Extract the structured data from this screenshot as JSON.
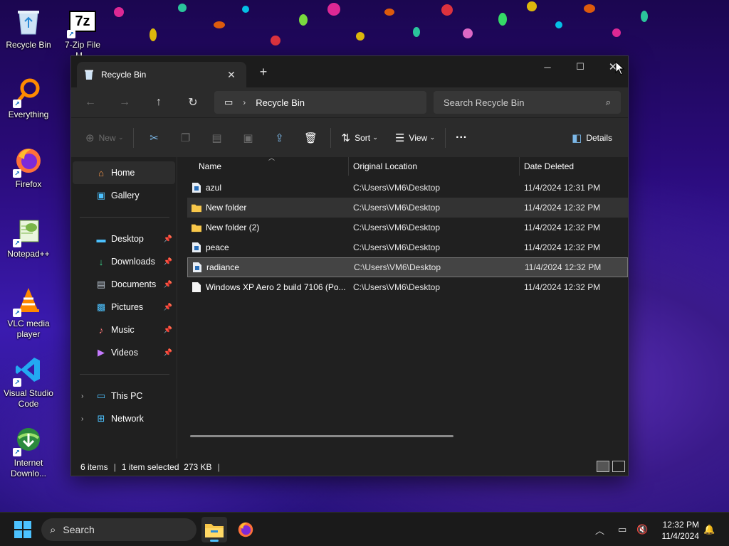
{
  "desktop": {
    "icons": [
      {
        "label": "Recycle Bin",
        "icon": "recycle-bin-icon"
      },
      {
        "label": "7-Zip File M...",
        "icon": "7zip-icon"
      },
      {
        "label": "Everything",
        "icon": "everything-icon"
      },
      {
        "label": "Firefox",
        "icon": "firefox-icon"
      },
      {
        "label": "Notepad++",
        "icon": "notepadpp-icon"
      },
      {
        "label": "VLC media player",
        "icon": "vlc-icon"
      },
      {
        "label": "Visual Studio Code",
        "icon": "vscode-icon"
      },
      {
        "label": "Internet Downlo...",
        "icon": "idm-icon"
      }
    ]
  },
  "window": {
    "tab_title": "Recycle Bin",
    "address": "Recycle Bin",
    "search_placeholder": "Search Recycle Bin",
    "commands": {
      "new": "New",
      "sort": "Sort",
      "view": "View",
      "more": "···",
      "details": "Details"
    },
    "nav": {
      "home": "Home",
      "gallery": "Gallery",
      "desktop": "Desktop",
      "downloads": "Downloads",
      "documents": "Documents",
      "pictures": "Pictures",
      "music": "Music",
      "videos": "Videos",
      "this_pc": "This PC",
      "network": "Network"
    },
    "columns": {
      "name": "Name",
      "location": "Original Location",
      "date": "Date Deleted"
    },
    "files": [
      {
        "name": "azul",
        "location": "C:\\Users\\VM6\\Desktop",
        "date": "11/4/2024 12:31 PM",
        "type": "file"
      },
      {
        "name": "New folder",
        "location": "C:\\Users\\VM6\\Desktop",
        "date": "11/4/2024 12:32 PM",
        "type": "folder"
      },
      {
        "name": "New folder (2)",
        "location": "C:\\Users\\VM6\\Desktop",
        "date": "11/4/2024 12:32 PM",
        "type": "folder"
      },
      {
        "name": "peace",
        "location": "C:\\Users\\VM6\\Desktop",
        "date": "11/4/2024 12:32 PM",
        "type": "file"
      },
      {
        "name": "radiance",
        "location": "C:\\Users\\VM6\\Desktop",
        "date": "11/4/2024 12:32 PM",
        "type": "file"
      },
      {
        "name": "Windows XP Aero 2 build 7106 (Po...",
        "location": "C:\\Users\\VM6\\Desktop",
        "date": "11/4/2024 12:32 PM",
        "type": "doc"
      }
    ],
    "status": {
      "items": "6 items",
      "selected": "1 item selected  273 KB"
    }
  },
  "taskbar": {
    "search": "Search",
    "time": "12:32 PM",
    "date": "11/4/2024"
  }
}
